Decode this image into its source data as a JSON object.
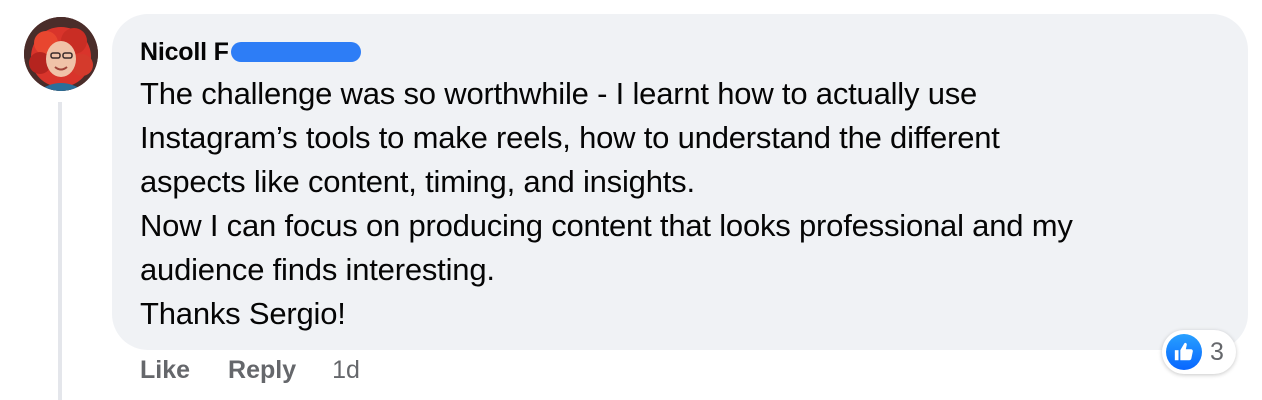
{
  "comment": {
    "author": "Nicoll F",
    "author_redacted": true,
    "paragraphs": [
      "The challenge was so worthwhile - I learnt how to actually use",
      "Instagram’s tools to make reels, how to understand the different",
      "aspects like content, timing, and insights.",
      "Now I can focus on producing content that looks professional and my",
      "audience finds interesting.",
      "Thanks Sergio!"
    ]
  },
  "actions": {
    "like_label": "Like",
    "reply_label": "Reply",
    "timestamp": "1d"
  },
  "reactions": {
    "icon": "thumbs-up-icon",
    "count": "3",
    "badge_color": "#1877f2"
  },
  "colors": {
    "bubble": "#f0f2f5",
    "text": "#050505",
    "secondary": "#65676b",
    "redaction": "#2d7df6"
  }
}
